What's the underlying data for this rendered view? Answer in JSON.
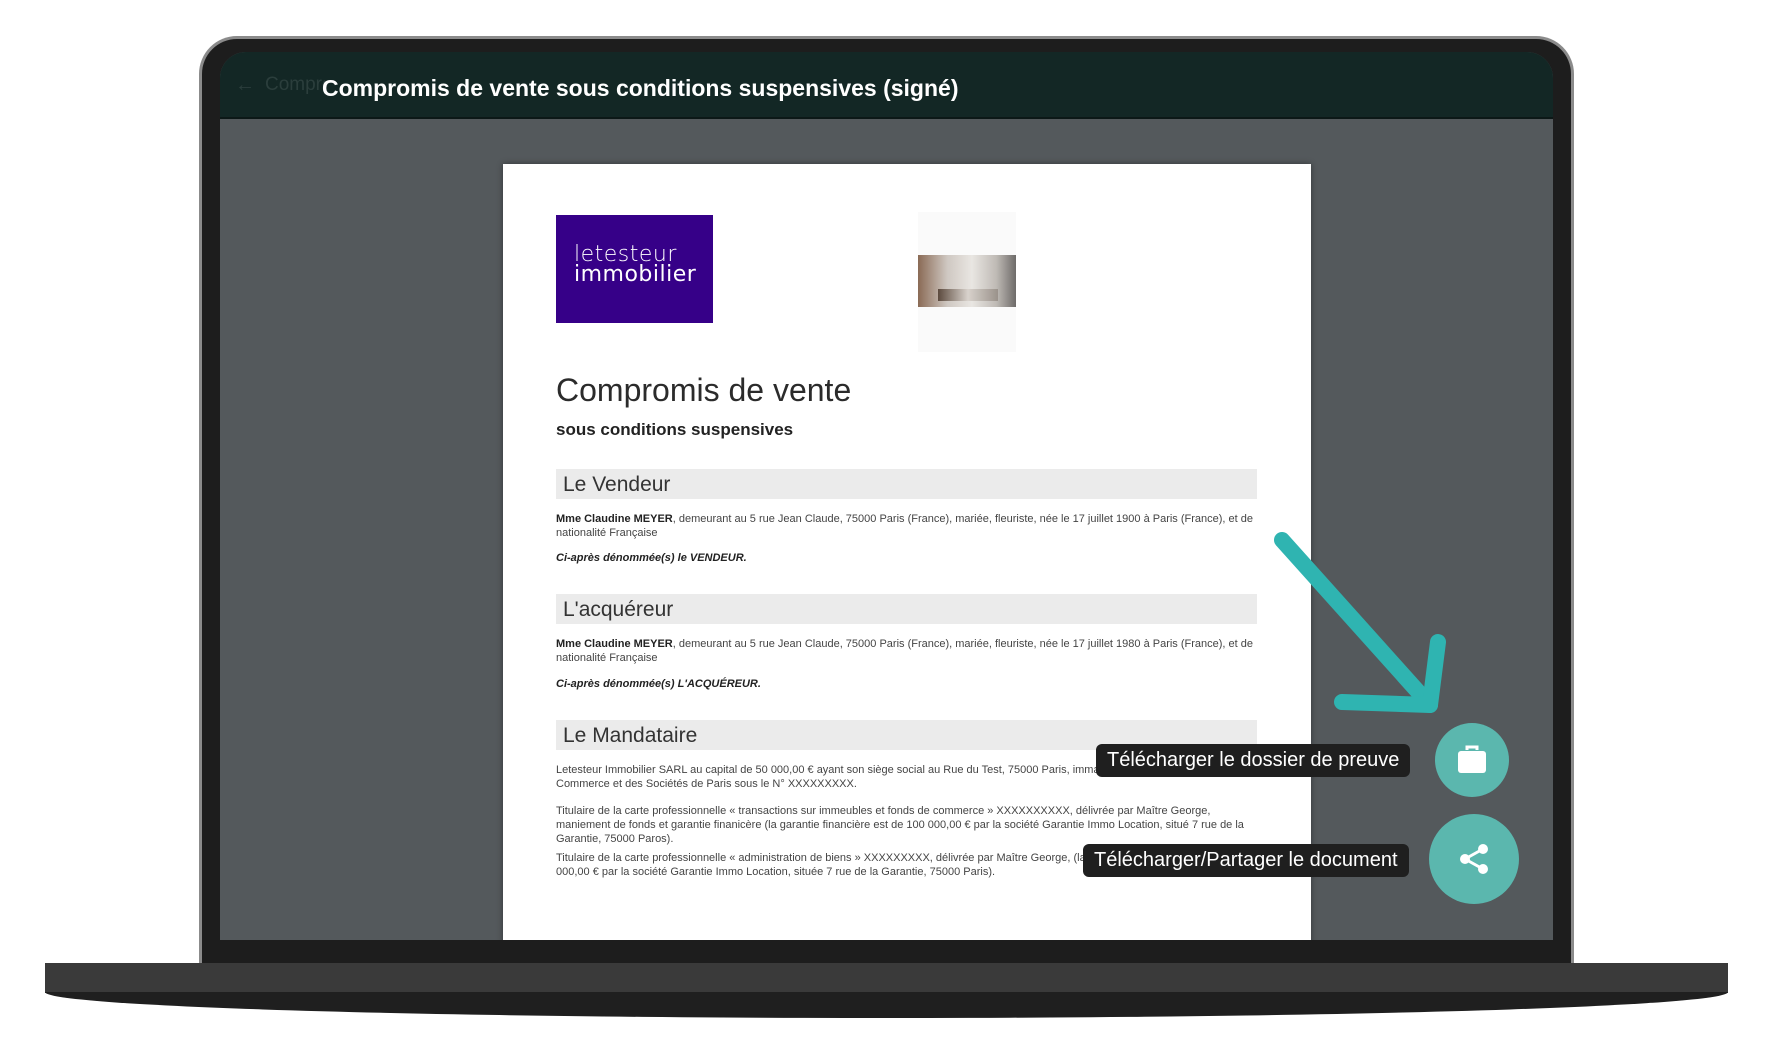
{
  "app": {
    "title": "Compromis de vente sous conditions suspensives (signé)",
    "ghost_title": "Compromis de vente sous conditions suspensives (signé)",
    "back_icon": "arrow-left-icon"
  },
  "document": {
    "logo": {
      "line1": "letesteur",
      "line2": "immobilier",
      "bg_color": "#360088"
    },
    "title": "Compromis de vente",
    "subtitle": "sous conditions suspensives",
    "sections": [
      {
        "heading": "Le Vendeur",
        "party_name": "Mme Claudine MEYER",
        "party_text": ", demeurant au 5 rue Jean Claude, 75000 Paris (France), mariée, fleuriste, née le 17 juillet 1900 à Paris (France), et de nationalité Française",
        "note": "Ci-après dénommée(s) le VENDEUR."
      },
      {
        "heading": "L'acquéreur",
        "party_name": "Mme Claudine MEYER",
        "party_text": ", demeurant au 5 rue Jean Claude, 75000 Paris (France), mariée, fleuriste, née le 17 juillet 1980 à Paris (France), et de nationalité Française",
        "note": "Ci-après dénommée(s) L'ACQUÉREUR."
      },
      {
        "heading": "Le Mandataire",
        "paragraphs": [
          "Letesteur Immobilier SARL au capital de 50 000,00 € ayant son siège social au Rue du Test, 75000 Paris, immatriculée au Registre du Commerce et des Sociétés de Paris sous le N° XXXXXXXXX.",
          "Titulaire de la carte professionnelle « transactions sur immeubles et fonds de commerce » XXXXXXXXXX, délivrée par Maître George, maniement de fonds et garantie finanicère (la garantie financière est de 100 000,00 € par la société Garantie Immo Location, situé 7 rue de la Garantie, 75000 Paros).",
          "Titulaire de la carte professionnelle « administration de biens » XXXXXXXXX, délivrée par Maître George, (la garantie financière est de 100 000,00 € par la société Garantie Immo Location, située 7 rue de la Garantie, 75000 Paris)."
        ]
      }
    ]
  },
  "actions": {
    "proof": {
      "label": "Télécharger le dossier de preuve",
      "icon": "briefcase-icon"
    },
    "share": {
      "label": "Télécharger/Partager le document",
      "icon": "share-icon"
    },
    "accent_color": "#5bb7ae",
    "arrow_color": "#2fb4b1"
  }
}
